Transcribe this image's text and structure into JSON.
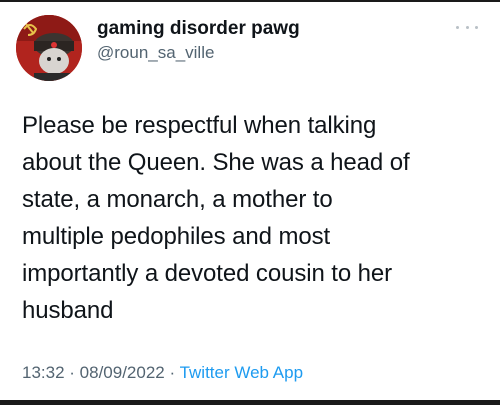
{
  "author": {
    "display_name": "gaming disorder pawg",
    "handle": "@roun_sa_ville",
    "avatar_icon": "avatar-soviet-hat-icon"
  },
  "tweet": {
    "lines": [
      "Please be respectful when talking",
      "about the Queen. She was a head of",
      "state, a monarch, a mother to",
      "multiple pedophiles and most",
      "importantly a devoted cousin to her",
      "husband"
    ]
  },
  "meta": {
    "time": "13:32",
    "separator": " · ",
    "date": "08/09/2022",
    "source": "Twitter Web App"
  },
  "icons": {
    "more": "more-options-icon"
  },
  "colors": {
    "text": "#0f1419",
    "secondary": "#536471",
    "link": "#1d9bf0",
    "avatar_bg": "#b1241e"
  }
}
